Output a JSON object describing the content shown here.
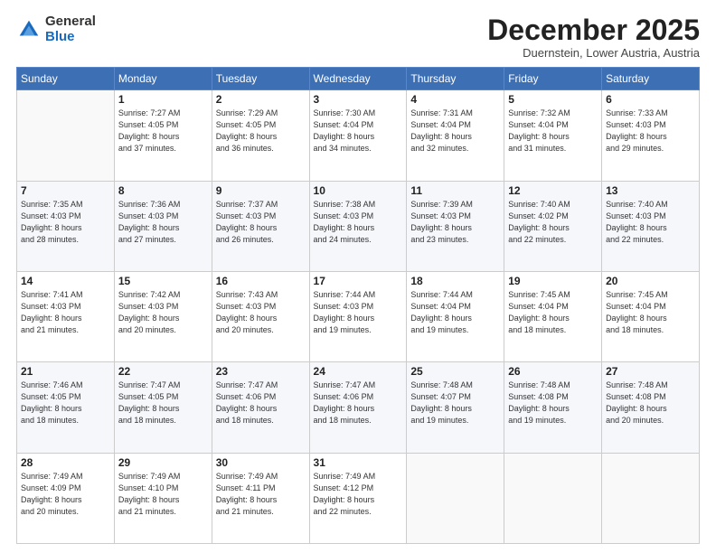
{
  "logo": {
    "general": "General",
    "blue": "Blue"
  },
  "title": "December 2025",
  "location": "Duernstein, Lower Austria, Austria",
  "days_header": [
    "Sunday",
    "Monday",
    "Tuesday",
    "Wednesday",
    "Thursday",
    "Friday",
    "Saturday"
  ],
  "weeks": [
    [
      {
        "day": "",
        "info": ""
      },
      {
        "day": "1",
        "info": "Sunrise: 7:27 AM\nSunset: 4:05 PM\nDaylight: 8 hours\nand 37 minutes."
      },
      {
        "day": "2",
        "info": "Sunrise: 7:29 AM\nSunset: 4:05 PM\nDaylight: 8 hours\nand 36 minutes."
      },
      {
        "day": "3",
        "info": "Sunrise: 7:30 AM\nSunset: 4:04 PM\nDaylight: 8 hours\nand 34 minutes."
      },
      {
        "day": "4",
        "info": "Sunrise: 7:31 AM\nSunset: 4:04 PM\nDaylight: 8 hours\nand 32 minutes."
      },
      {
        "day": "5",
        "info": "Sunrise: 7:32 AM\nSunset: 4:04 PM\nDaylight: 8 hours\nand 31 minutes."
      },
      {
        "day": "6",
        "info": "Sunrise: 7:33 AM\nSunset: 4:03 PM\nDaylight: 8 hours\nand 29 minutes."
      }
    ],
    [
      {
        "day": "7",
        "info": "Sunrise: 7:35 AM\nSunset: 4:03 PM\nDaylight: 8 hours\nand 28 minutes."
      },
      {
        "day": "8",
        "info": "Sunrise: 7:36 AM\nSunset: 4:03 PM\nDaylight: 8 hours\nand 27 minutes."
      },
      {
        "day": "9",
        "info": "Sunrise: 7:37 AM\nSunset: 4:03 PM\nDaylight: 8 hours\nand 26 minutes."
      },
      {
        "day": "10",
        "info": "Sunrise: 7:38 AM\nSunset: 4:03 PM\nDaylight: 8 hours\nand 24 minutes."
      },
      {
        "day": "11",
        "info": "Sunrise: 7:39 AM\nSunset: 4:03 PM\nDaylight: 8 hours\nand 23 minutes."
      },
      {
        "day": "12",
        "info": "Sunrise: 7:40 AM\nSunset: 4:02 PM\nDaylight: 8 hours\nand 22 minutes."
      },
      {
        "day": "13",
        "info": "Sunrise: 7:40 AM\nSunset: 4:03 PM\nDaylight: 8 hours\nand 22 minutes."
      }
    ],
    [
      {
        "day": "14",
        "info": "Sunrise: 7:41 AM\nSunset: 4:03 PM\nDaylight: 8 hours\nand 21 minutes."
      },
      {
        "day": "15",
        "info": "Sunrise: 7:42 AM\nSunset: 4:03 PM\nDaylight: 8 hours\nand 20 minutes."
      },
      {
        "day": "16",
        "info": "Sunrise: 7:43 AM\nSunset: 4:03 PM\nDaylight: 8 hours\nand 20 minutes."
      },
      {
        "day": "17",
        "info": "Sunrise: 7:44 AM\nSunset: 4:03 PM\nDaylight: 8 hours\nand 19 minutes."
      },
      {
        "day": "18",
        "info": "Sunrise: 7:44 AM\nSunset: 4:04 PM\nDaylight: 8 hours\nand 19 minutes."
      },
      {
        "day": "19",
        "info": "Sunrise: 7:45 AM\nSunset: 4:04 PM\nDaylight: 8 hours\nand 18 minutes."
      },
      {
        "day": "20",
        "info": "Sunrise: 7:45 AM\nSunset: 4:04 PM\nDaylight: 8 hours\nand 18 minutes."
      }
    ],
    [
      {
        "day": "21",
        "info": "Sunrise: 7:46 AM\nSunset: 4:05 PM\nDaylight: 8 hours\nand 18 minutes."
      },
      {
        "day": "22",
        "info": "Sunrise: 7:47 AM\nSunset: 4:05 PM\nDaylight: 8 hours\nand 18 minutes."
      },
      {
        "day": "23",
        "info": "Sunrise: 7:47 AM\nSunset: 4:06 PM\nDaylight: 8 hours\nand 18 minutes."
      },
      {
        "day": "24",
        "info": "Sunrise: 7:47 AM\nSunset: 4:06 PM\nDaylight: 8 hours\nand 18 minutes."
      },
      {
        "day": "25",
        "info": "Sunrise: 7:48 AM\nSunset: 4:07 PM\nDaylight: 8 hours\nand 19 minutes."
      },
      {
        "day": "26",
        "info": "Sunrise: 7:48 AM\nSunset: 4:08 PM\nDaylight: 8 hours\nand 19 minutes."
      },
      {
        "day": "27",
        "info": "Sunrise: 7:48 AM\nSunset: 4:08 PM\nDaylight: 8 hours\nand 20 minutes."
      }
    ],
    [
      {
        "day": "28",
        "info": "Sunrise: 7:49 AM\nSunset: 4:09 PM\nDaylight: 8 hours\nand 20 minutes."
      },
      {
        "day": "29",
        "info": "Sunrise: 7:49 AM\nSunset: 4:10 PM\nDaylight: 8 hours\nand 21 minutes."
      },
      {
        "day": "30",
        "info": "Sunrise: 7:49 AM\nSunset: 4:11 PM\nDaylight: 8 hours\nand 21 minutes."
      },
      {
        "day": "31",
        "info": "Sunrise: 7:49 AM\nSunset: 4:12 PM\nDaylight: 8 hours\nand 22 minutes."
      },
      {
        "day": "",
        "info": ""
      },
      {
        "day": "",
        "info": ""
      },
      {
        "day": "",
        "info": ""
      }
    ]
  ]
}
